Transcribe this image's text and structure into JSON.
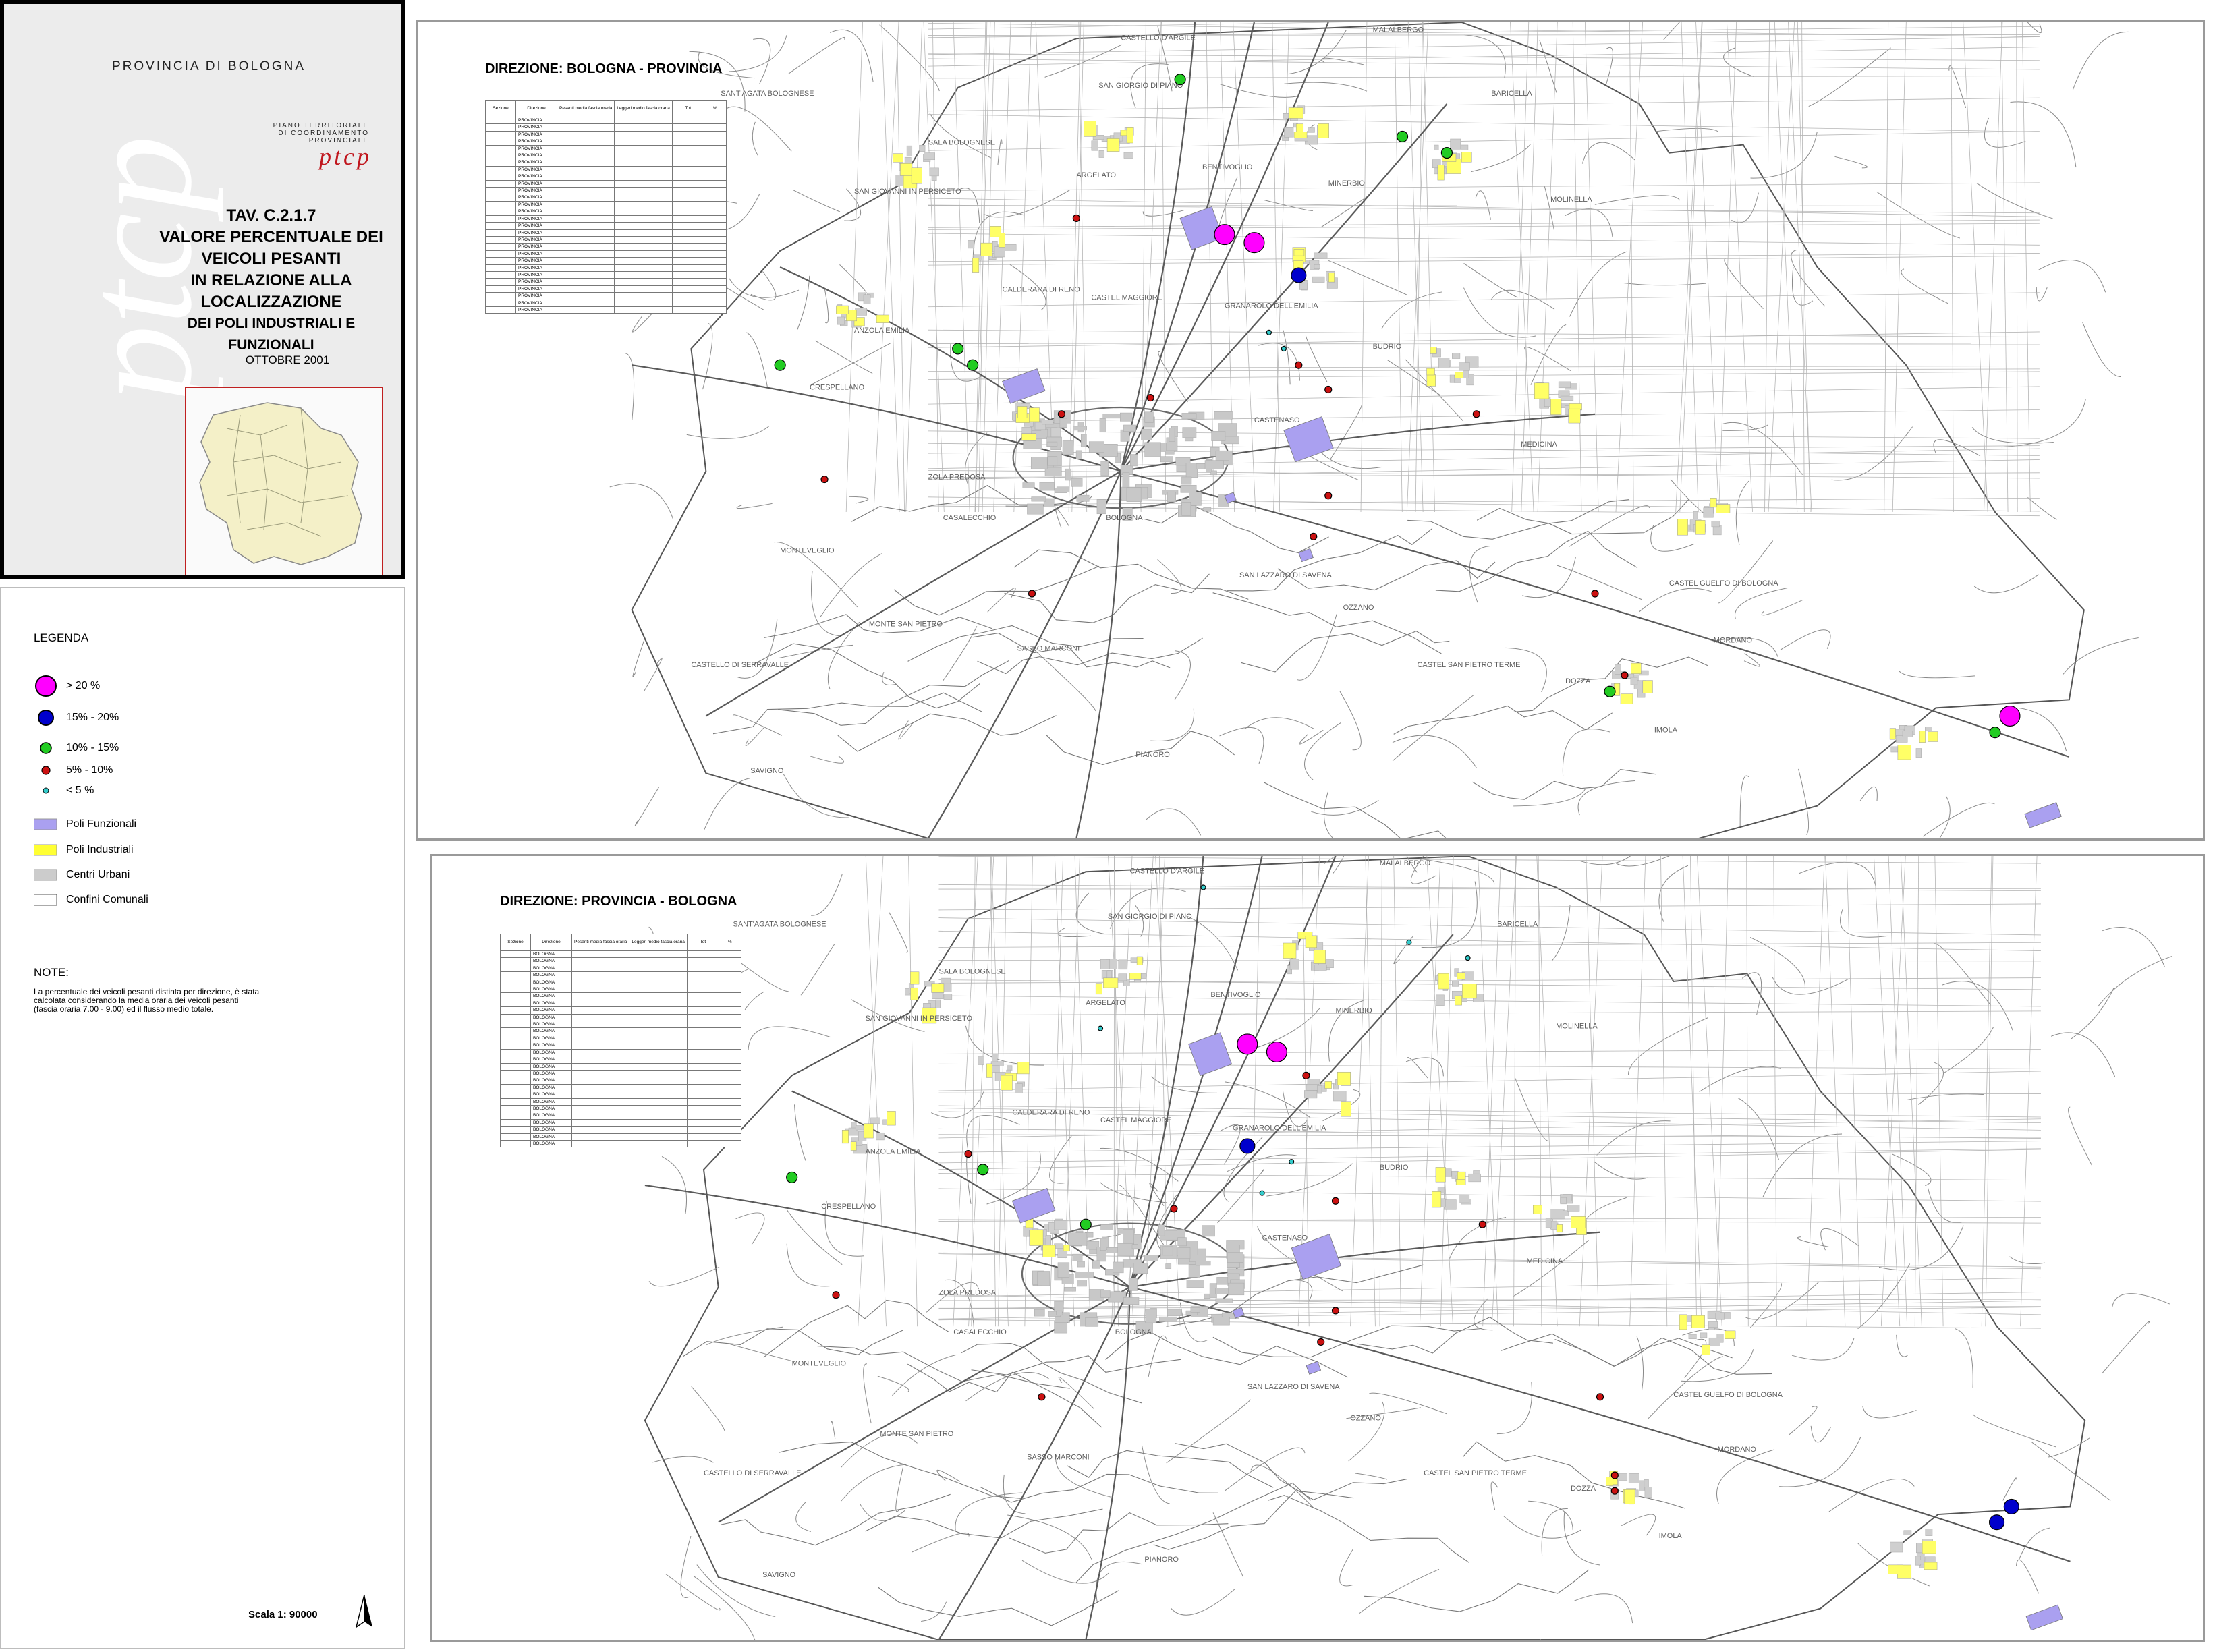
{
  "title_panel": {
    "province": "PROVINCIA DI BOLOGNA",
    "plan_line1": "PIANO TERRITORIALE",
    "plan_line2": "DI COORDINAMENTO",
    "plan_line3": "PROVINCIALE",
    "logo": "ptcp",
    "title_lines": [
      "TAV. C.2.1.7",
      "VALORE PERCENTUALE DEI",
      "VEICOLI PESANTI",
      "IN RELAZIONE ALLA",
      "LOCALIZZAZIONE",
      "DEI POLI INDUSTRIALI E FUNZIONALI"
    ],
    "date": "OTTOBRE 2001"
  },
  "legend": {
    "title": "LEGENDA",
    "classes": [
      {
        "label": "> 20 %",
        "color": "#ff00ff"
      },
      {
        "label": "15% - 20%",
        "color": "#0000cc"
      },
      {
        "label": "10% - 15%",
        "color": "#22cc22"
      },
      {
        "label": "5% - 10%",
        "color": "#cc1111"
      },
      {
        "label": "< 5 %",
        "color": "#33cccc"
      }
    ],
    "areas": [
      {
        "label": "Poli Funzionali",
        "color": "#aaa0f0"
      },
      {
        "label": "Poli Industriali",
        "color": "#ffff33"
      },
      {
        "label": "Centri Urbani",
        "color": "#cccccc"
      },
      {
        "label": "Confini Comunali",
        "color": "#ffffff"
      }
    ],
    "notes_title": "NOTE:",
    "notes_text": "La percentuale dei veicoli pesanti distinta per direzione, è stata calcolata considerando la media oraria dei veicoli pesanti (fascia oraria 7.00 - 9.00) ed il flusso medio totale.",
    "scale": "Scala 1: 90000"
  },
  "map_top": {
    "title": "DIREZIONE: BOLOGNA - PROVINCIA",
    "table_headers": [
      "Sezione",
      "Direzione",
      "Pesanti media fascia oraria",
      "Leggeri medio fascia oraria",
      "Tot",
      "%"
    ],
    "direction": "PROVINCIA",
    "row_count": 28
  },
  "map_bottom": {
    "title": "DIREZIONE: PROVINCIA - BOLOGNA",
    "table_headers": [
      "Sezione",
      "Direzione",
      "Pesanti media fascia oraria",
      "Leggeri medio fascia oraria",
      "Tot",
      "%"
    ],
    "direction": "BOLOGNA",
    "row_count": 28
  },
  "places": [
    "CASTELLO D'ARGILE",
    "MALALBERGO",
    "BARICELLA",
    "SANT'AGATA BOLOGNESE",
    "SAN GIORGIO DI PIANO",
    "BENTIVOGLIO",
    "SALA BOLOGNESE",
    "ARGELATO",
    "MINERBIO",
    "SAN GIOVANNI IN PERSICETO",
    "MOLINELLA",
    "CASTEL MAGGIORE",
    "GRANAROLO DELL'EMILIA",
    "CALDERARA DI RENO",
    "ANZOLA EMILIA",
    "BUDRIO",
    "CRESPELLANO",
    "CASTENASO",
    "MEDICINA",
    "ZOLA PREDOSA",
    "BOLOGNA",
    "CASALECCHIO",
    "MONTEVEGLIO",
    "SAN LAZZARO DI SAVENA",
    "CASTEL GUELFO DI BOLOGNA",
    "OZZANO",
    "MONTE SAN PIETRO",
    "SASSO MARCONI",
    "CASTEL SAN PIETRO TERME",
    "MORDANO",
    "CASTELLO DI SERRAVALLE",
    "DOZZA",
    "IMOLA",
    "PIANORO",
    "SAVIGNO"
  ],
  "icons": [
    "north-arrow-icon"
  ]
}
